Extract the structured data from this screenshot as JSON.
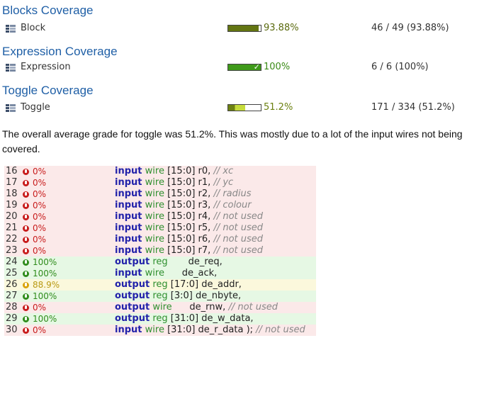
{
  "sections": [
    {
      "title": "Blocks Coverage",
      "metric": "Block",
      "percent": "93.88%",
      "count": "46 / 49 (93.88%)",
      "fill": 0.9388,
      "style": "olive"
    },
    {
      "title": "Expression Coverage",
      "metric": "Expression",
      "percent": "100%",
      "count": "6 / 6 (100%)",
      "fill": 1.0,
      "style": "green"
    },
    {
      "title": "Toggle Coverage",
      "metric": "Toggle",
      "percent": "51.2%",
      "count": "171 / 334 (51.2%)",
      "fill": 0.512,
      "style": "lime"
    }
  ],
  "description": "The overall average grade for toggle was 51.2%. This was mostly due to a lot of the input wires not being covered.",
  "code_lines": [
    {
      "num": "16",
      "cov": "0%",
      "status": "red",
      "kw": "input",
      "type": "wire",
      "rest": "[15:0] r0,",
      "comment": "// xc"
    },
    {
      "num": "17",
      "cov": "0%",
      "status": "red",
      "kw": "input",
      "type": "wire",
      "rest": "[15:0] r1,",
      "comment": "// yc"
    },
    {
      "num": "18",
      "cov": "0%",
      "status": "red",
      "kw": "input",
      "type": "wire",
      "rest": "[15:0] r2,",
      "comment": "// radius"
    },
    {
      "num": "19",
      "cov": "0%",
      "status": "red",
      "kw": "input",
      "type": "wire",
      "rest": "[15:0] r3,",
      "comment": "// colour"
    },
    {
      "num": "20",
      "cov": "0%",
      "status": "red",
      "kw": "input",
      "type": "wire",
      "rest": "[15:0] r4,",
      "comment": "// not used"
    },
    {
      "num": "21",
      "cov": "0%",
      "status": "red",
      "kw": "input",
      "type": "wire",
      "rest": "[15:0] r5,",
      "comment": "// not used"
    },
    {
      "num": "22",
      "cov": "0%",
      "status": "red",
      "kw": "input",
      "type": "wire",
      "rest": "[15:0] r6,",
      "comment": "// not used"
    },
    {
      "num": "23",
      "cov": "0%",
      "status": "red",
      "kw": "input",
      "type": "wire",
      "rest": "[15:0] r7,",
      "comment": "// not used"
    },
    {
      "num": "24",
      "cov": "100%",
      "status": "green",
      "kw": "output",
      "type": "reg",
      "rest": "      de_req,",
      "comment": ""
    },
    {
      "num": "25",
      "cov": "100%",
      "status": "green",
      "kw": "input",
      "type": "wire",
      "rest": "     de_ack,",
      "comment": ""
    },
    {
      "num": "26",
      "cov": "88.9%",
      "status": "yellow",
      "kw": "output",
      "type": "reg",
      "rest": "[17:0] de_addr,",
      "comment": ""
    },
    {
      "num": "27",
      "cov": "100%",
      "status": "green",
      "kw": "output",
      "type": "reg",
      "rest": "[3:0] de_nbyte,",
      "comment": ""
    },
    {
      "num": "28",
      "cov": "0%",
      "status": "red",
      "kw": "output",
      "type": "wire",
      "rest": "     de_rnw,",
      "comment": "// not used"
    },
    {
      "num": "29",
      "cov": "100%",
      "status": "green",
      "kw": "output",
      "type": "reg",
      "rest": "[31:0] de_w_data,",
      "comment": ""
    },
    {
      "num": "30",
      "cov": "0%",
      "status": "red",
      "kw": "input",
      "type": "wire",
      "rest": "[31:0] de_r_data );",
      "comment": "// not used"
    }
  ]
}
